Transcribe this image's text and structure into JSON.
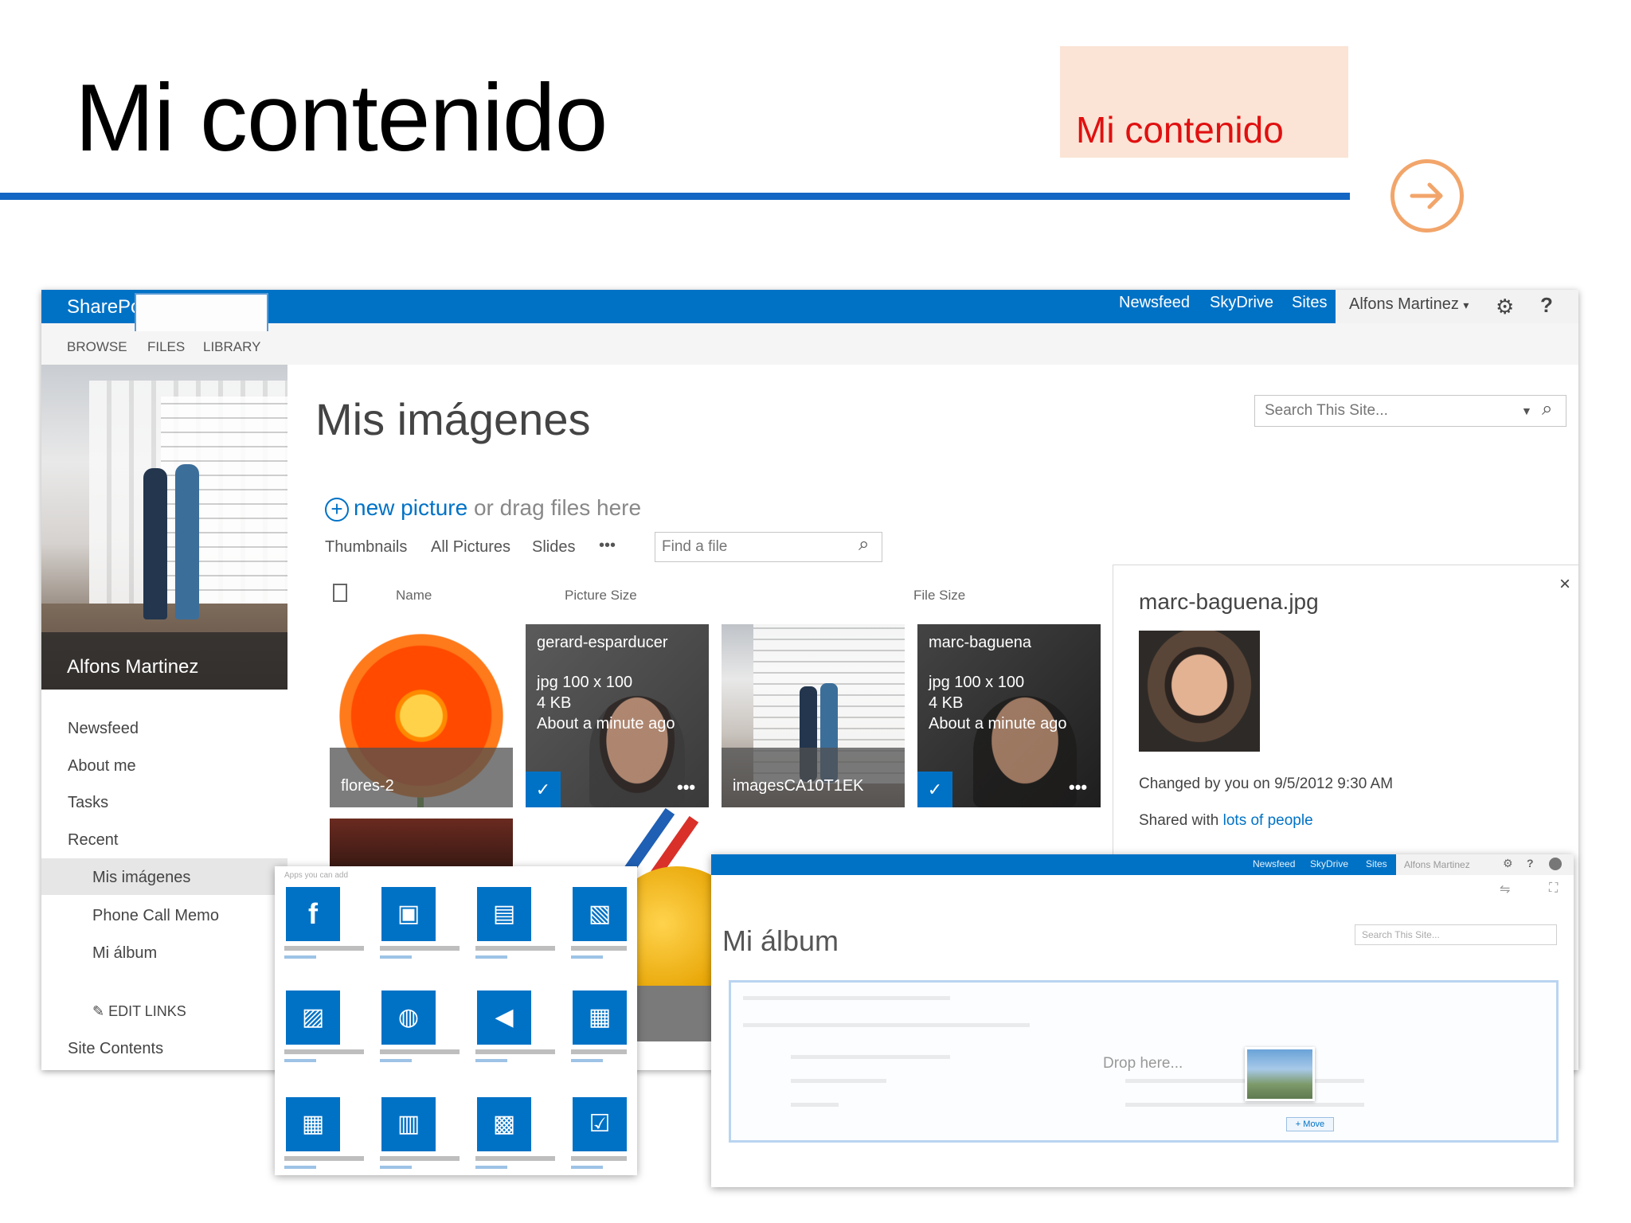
{
  "slide": {
    "title": "Mi contenido",
    "callout": "Mi contenido",
    "colors": {
      "rule": "#1366c3",
      "callout_bg": "#fbe4d5",
      "callout_text": "#e01010",
      "arrow": "#f2a56a"
    },
    "arrow_icon": "arrow-right-circle-icon"
  },
  "sharepoint": {
    "brand": "SharePoint",
    "suite_links": [
      "Newsfeed",
      "SkyDrive",
      "Sites"
    ],
    "user": "Alfons Martinez",
    "user_caret": "▾",
    "gear": "⚙",
    "help": "?",
    "ribbon_tabs": [
      "BROWSE",
      "FILES",
      "LIBRARY"
    ],
    "accent": "#0072c6"
  },
  "left_nav": {
    "profile_name": "Alfons Martinez",
    "items": [
      "Newsfeed",
      "About me",
      "Tasks",
      "Recent"
    ],
    "recent_items": [
      "Mis imágenes",
      "Phone Call Memo",
      "Mi álbum"
    ],
    "edit_links": "EDIT LINKS",
    "site_contents": "Site Contents"
  },
  "main": {
    "title": "Mis imágenes",
    "search_placeholder": "Search This Site...",
    "new_picture": "new picture",
    "drag_text": "or drag files here",
    "views": [
      "Thumbnails",
      "All Pictures",
      "Slides",
      "•••"
    ],
    "find_placeholder": "Find a file",
    "columns": [
      "Name",
      "Picture Size",
      "File Size"
    ],
    "tiles": [
      {
        "name": "flores-2"
      },
      {
        "name": "gerard-esparducer",
        "type_size": "jpg 100 x 100",
        "file_size": "4 KB",
        "modified": "About a minute ago"
      },
      {
        "name": "imagesCA10T1EK"
      },
      {
        "name": "marc-baguena",
        "type_size": "jpg 100 x 100",
        "file_size": "4 KB",
        "modified": "About a minute ago"
      }
    ],
    "check": "✓",
    "more": "•••"
  },
  "details": {
    "file": "marc-baguena.jpg",
    "close": "×",
    "changed": "Changed by you on 9/5/2012 9:30 AM",
    "shared_prefix": "Shared with",
    "shared_link": "lots of people"
  },
  "apps_panel": {
    "header": "Apps you can add",
    "icons": [
      "facebook-icon",
      "document-library-icon",
      "form-library-icon",
      "wiki-page-library-icon",
      "picture-library-icon",
      "links-icon",
      "announcements-icon",
      "contacts-icon",
      "calendar-icon",
      "promoted-links-icon",
      "discussion-board-icon",
      "tasks-icon"
    ]
  },
  "album": {
    "title": "Mi álbum",
    "links": [
      "Newsfeed",
      "SkyDrive",
      "Sites"
    ],
    "user": "Alfons Martinez",
    "search_placeholder": "Search This Site...",
    "drop_text": "Drop here...",
    "move": "+ Move"
  }
}
